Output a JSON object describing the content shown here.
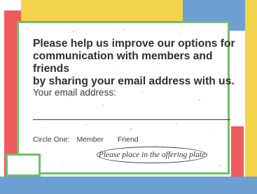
{
  "form": {
    "headline_line1": "Please help us improve our options for",
    "headline_line2": "communication with members and friends",
    "headline_line3": "by sharing your email address with us.",
    "email_label": "Your email address:",
    "circle_one_label": "Circle One:",
    "option_member": "Member",
    "option_friend": "Friend",
    "offering_note": "Please place in the offering plate"
  },
  "colors": {
    "yellow": "#f2d54d",
    "blue": "#6e9fd3",
    "red": "#ef5a5c",
    "green": "#6fbf6a"
  }
}
